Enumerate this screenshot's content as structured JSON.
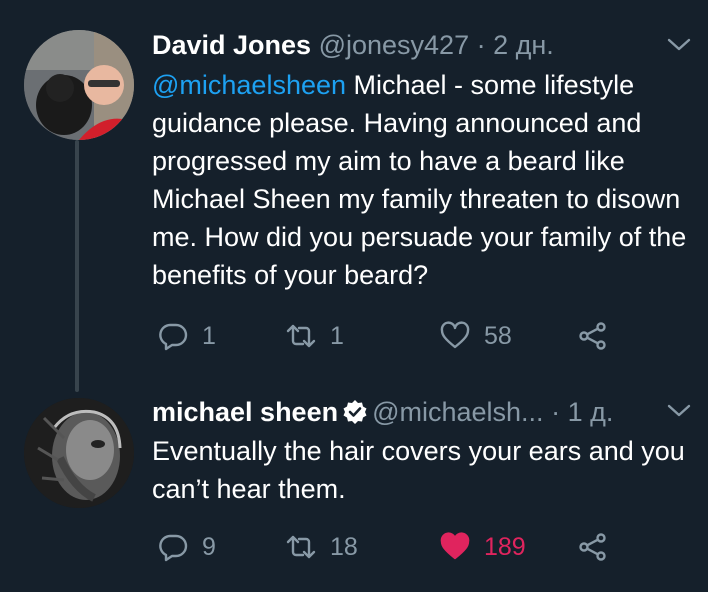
{
  "tweets": [
    {
      "name": "David Jones",
      "handle": "@jonesy427",
      "separator": "·",
      "time": "2 дн.",
      "mention": "@michaelsheen",
      "text": " Michael - some lifestyle guidance please. Having announced and progressed my aim to have a beard like Michael Sheen my family threaten to disown me. How did you persuade your family of the benefits of your beard?",
      "replies": "1",
      "retweets": "1",
      "likes": "58",
      "liked": false
    },
    {
      "name": "michael sheen",
      "handle": "@michaelsh...",
      "separator": "·",
      "time": "1 д.",
      "verified": true,
      "text": "Eventually the hair covers your ears and you can’t hear them.",
      "replies": "9",
      "retweets": "18",
      "likes": "189",
      "liked": true
    }
  ],
  "icons": {
    "reply": "reply-icon",
    "retweet": "retweet-icon",
    "like": "heart-icon",
    "share": "share-icon",
    "caret": "chevron-down-icon",
    "verified": "verified-badge-icon"
  },
  "colors": {
    "background": "#15202b",
    "muted": "#8899a6",
    "link": "#1da1f2",
    "like_active": "#e0245e",
    "thread_line": "#38444d"
  }
}
